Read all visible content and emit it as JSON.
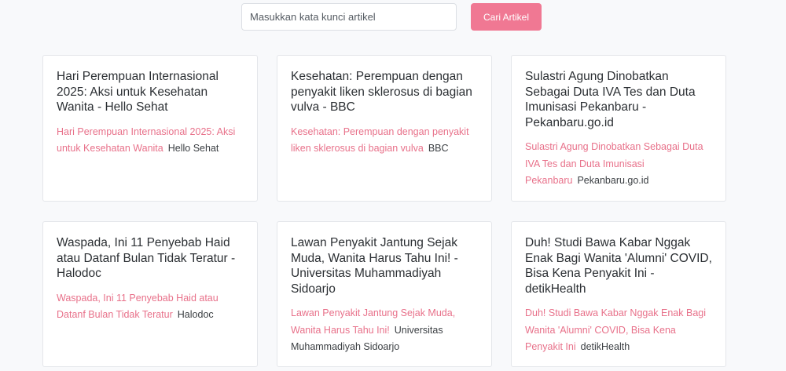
{
  "search": {
    "placeholder": "Masukkan kata kunci artikel",
    "value": "",
    "button_label": "Cari Artikel",
    "button_color": "#f07893"
  },
  "colors": {
    "accent": "#f07893",
    "link": "#e8718a",
    "background": "#f8f9fb",
    "card": "#ffffff"
  },
  "articles": [
    {
      "title": "Hari Perempuan Internasional 2025: Aksi untuk Kesehatan Wanita - Hello Sehat",
      "link_text": "Hari Perempuan Internasional 2025: Aksi untuk Kesehatan Wanita",
      "source": "Hello Sehat"
    },
    {
      "title": "Kesehatan: Perempuan dengan penyakit liken sklerosus di bagian vulva - BBC",
      "link_text": "Kesehatan: Perempuan dengan penyakit liken sklerosus di bagian vulva",
      "source": "BBC"
    },
    {
      "title": "Sulastri Agung Dinobatkan Sebagai Duta IVA Tes dan Duta Imunisasi Pekanbaru - Pekanbaru.go.id",
      "link_text": "Sulastri Agung Dinobatkan Sebagai Duta IVA Tes dan Duta Imunisasi Pekanbaru",
      "source": "Pekanbaru.go.id"
    },
    {
      "title": "Waspada, Ini 11 Penyebab Haid atau Datanf Bulan Tidak Teratur - Halodoc",
      "link_text": "Waspada, Ini 11 Penyebab Haid atau Datanf Bulan Tidak Teratur",
      "source": "Halodoc"
    },
    {
      "title": "Lawan Penyakit Jantung Sejak Muda, Wanita Harus Tahu Ini! - Universitas Muhammadiyah Sidoarjo",
      "link_text": "Lawan Penyakit Jantung Sejak Muda, Wanita Harus Tahu Ini!",
      "source": "Universitas Muhammadiyah Sidoarjo"
    },
    {
      "title": "Duh! Studi Bawa Kabar Nggak Enak Bagi Wanita 'Alumni' COVID, Bisa Kena Penyakit Ini - detikHealth",
      "link_text": "Duh! Studi Bawa Kabar Nggak Enak Bagi Wanita 'Alumni' COVID, Bisa Kena Penyakit Ini",
      "source": "detikHealth"
    }
  ]
}
